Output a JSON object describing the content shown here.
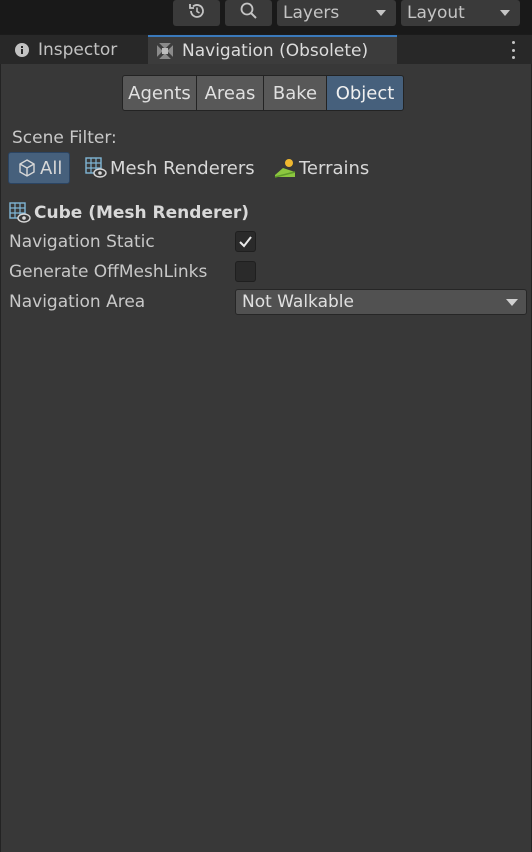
{
  "toolbar": {
    "history_icon": "history-icon",
    "search_icon": "search-icon",
    "layers_label": "Layers",
    "layout_label": "Layout"
  },
  "tabs": {
    "inspector_label": "Inspector",
    "navigation_label": "Navigation (Obsolete)"
  },
  "segmented": {
    "items": [
      "Agents",
      "Areas",
      "Bake",
      "Object"
    ],
    "active": "Object"
  },
  "scene_filter": {
    "label": "Scene Filter:",
    "all_label": "All",
    "mesh_renderers_label": "Mesh Renderers",
    "terrains_label": "Terrains"
  },
  "object": {
    "title": "Cube (Mesh Renderer)",
    "navigation_static_label": "Navigation Static",
    "navigation_static_checked": true,
    "generate_offmeshlinks_label": "Generate OffMeshLinks",
    "generate_offmeshlinks_checked": false,
    "navigation_area_label": "Navigation Area",
    "navigation_area_value": "Not Walkable"
  },
  "colors": {
    "accent": "#46607c",
    "tab_highlight": "#3a79bb",
    "panel_bg": "#383838"
  }
}
